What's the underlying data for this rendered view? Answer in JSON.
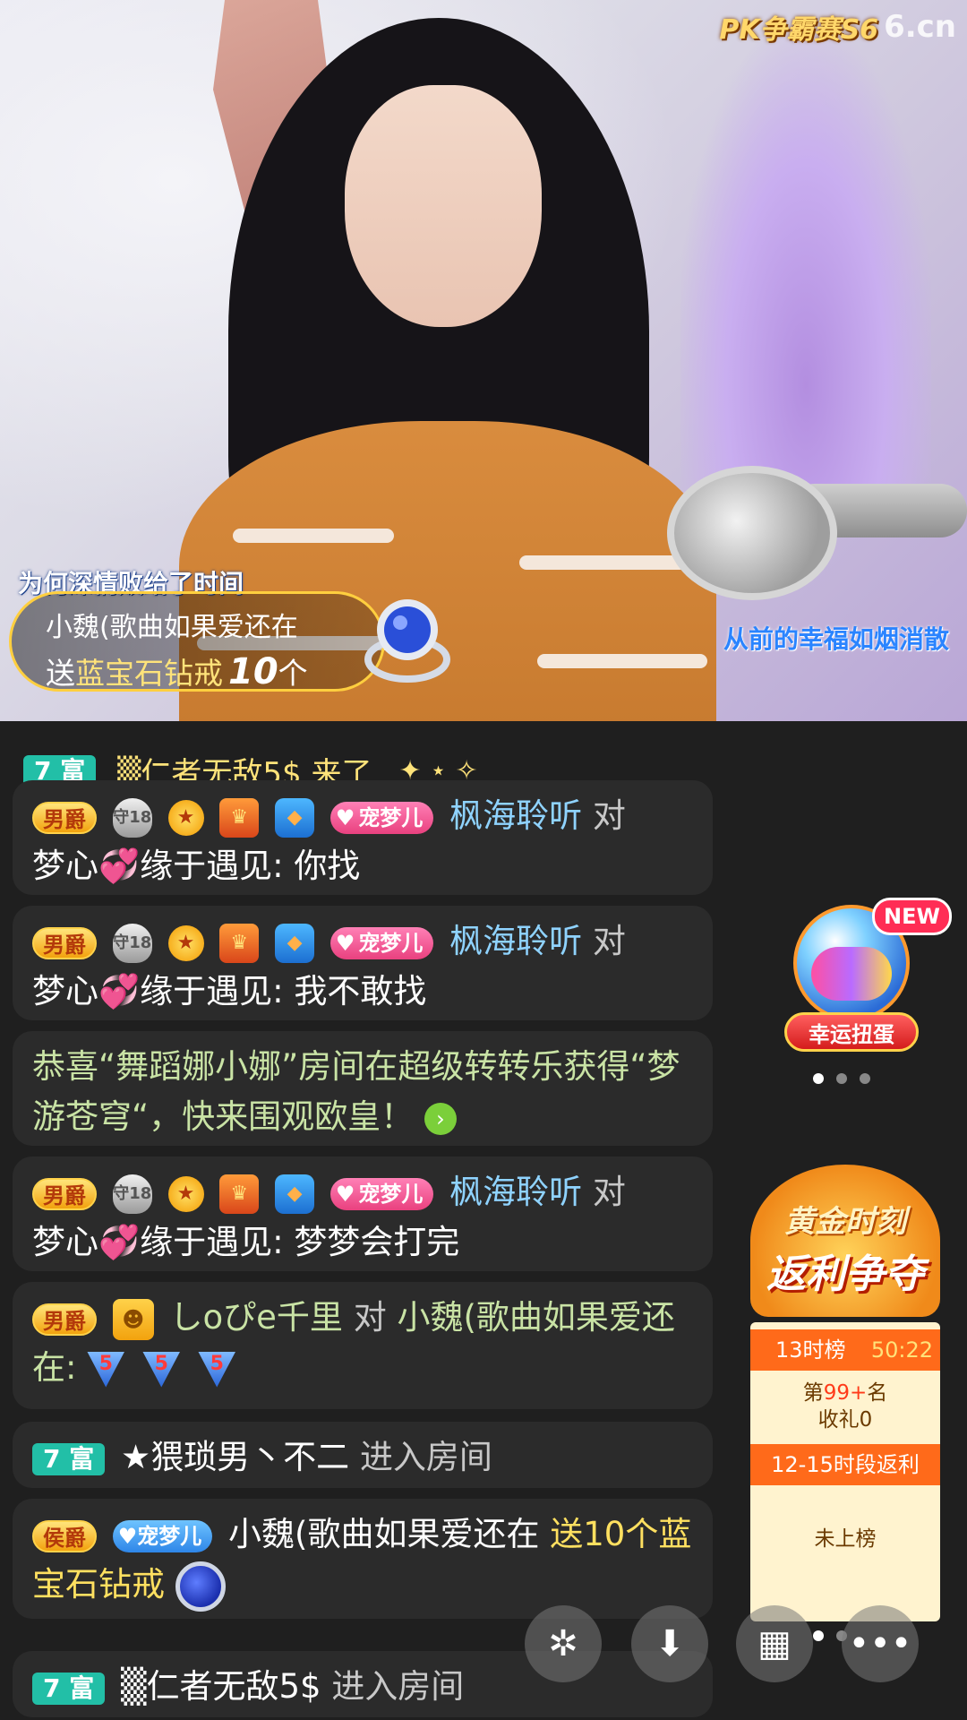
{
  "video": {
    "logo_text": "PK争霸赛S6",
    "logo_site": "6.cn",
    "lyric_left": "为何深情败给了时间",
    "lyric_right": "从前的幸福如烟消散",
    "gift_banner": {
      "sender": "小魏(歌曲如果爱还在",
      "verb": "送",
      "gift_name": "蓝宝石钻戒",
      "count": "10",
      "unit": "个"
    }
  },
  "chat": {
    "top_entry": {
      "rich_badge": "7 富",
      "text": "▒仁者无敌5$ 来了"
    },
    "messages": [
      {
        "rank": "男爵",
        "shield": "守18",
        "pet": "宠梦儿",
        "sender": "枫海聆听",
        "to_word": "对",
        "target": "梦心💞缘于遇见:",
        "content": "你找"
      },
      {
        "rank": "男爵",
        "shield": "守18",
        "pet": "宠梦儿",
        "sender": "枫海聆听",
        "to_word": "对",
        "target": "梦心💞缘于遇见:",
        "content": "我不敢找"
      },
      {
        "system": "恭喜“舞蹈娜小娜”房间在超级转转乐获得“梦游苍穹“，快来围观欧皇！"
      },
      {
        "rank": "男爵",
        "shield": "守18",
        "pet": "宠梦儿",
        "sender": "枫海聆听",
        "to_word": "对",
        "target": "梦心💞缘于遇见:",
        "content": "梦梦会打完"
      },
      {
        "rank": "男爵",
        "sender": "しoぴe千里",
        "to_word": "对",
        "target": "小魏(歌曲如果爱还在:",
        "gift_count_mark": "5"
      },
      {
        "rich_badge": "7 富",
        "sender": "★猥琐男丶不二",
        "action": "进入房间"
      },
      {
        "rank": "侯爵",
        "pet": "宠梦儿",
        "sender": "小魏(歌曲如果爱还在",
        "action": "送10个蓝宝石钻戒"
      },
      {
        "rich_badge": "7 富",
        "sender": "▒仁者无敌5$",
        "action": "进入房间"
      }
    ]
  },
  "side": {
    "gacha_new": "NEW",
    "gacha_label": "幸运扭蛋",
    "golden": {
      "title_top": "黄金时刻",
      "title_bottom": "返利争夺",
      "board": "13时榜",
      "countdown": "50:22",
      "rank_prefix": "第",
      "rank_value": "99+",
      "rank_suffix": "名",
      "gifts": "收礼0",
      "period": "12-15时段返利",
      "status": "未上榜"
    }
  },
  "toolbar": {
    "share_icon": "share-icon",
    "download_icon": "download-icon",
    "grid_icon": "grid-icon",
    "more_icon": "more-icon"
  }
}
